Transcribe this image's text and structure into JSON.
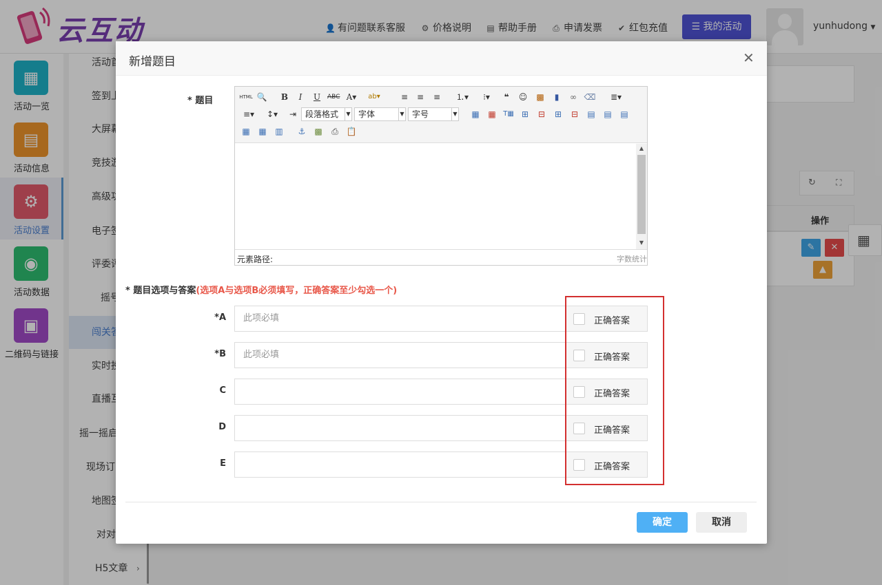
{
  "app": {
    "brand": "云互动"
  },
  "header": {
    "links": [
      {
        "label": "有问题联系客服",
        "icon": "user-plus-icon"
      },
      {
        "label": "价格说明",
        "icon": "gear-icon"
      },
      {
        "label": "帮助手册",
        "icon": "book-icon"
      },
      {
        "label": "申请发票",
        "icon": "printer-icon"
      },
      {
        "label": "红包充值",
        "icon": "shield-check-icon"
      }
    ],
    "my_activity": "我的活动",
    "username": "yunhudong"
  },
  "leftnav": {
    "items": [
      {
        "label": "活动一览",
        "icon": "grid-icon",
        "color": "#1fb3c9"
      },
      {
        "label": "活动信息",
        "icon": "document-icon",
        "color": "#f0962b"
      },
      {
        "label": "活动设置",
        "icon": "gear-icon",
        "color": "#e25b6c"
      },
      {
        "label": "活动数据",
        "icon": "database-icon",
        "color": "#2fbf71"
      },
      {
        "label": "二维码与链接",
        "icon": "qrcode-icon",
        "color": "#a24bc9"
      }
    ]
  },
  "subnav": {
    "items": [
      "活动首",
      "签到上",
      "大屏幕",
      "竞技游",
      "高级功",
      "电子签",
      "评委评",
      "摇号",
      "闯关答",
      "实时投",
      "直播互",
      "摇一摇启",
      "现场订",
      "地图签",
      "对对",
      "H5文章"
    ]
  },
  "content": {
    "action_header": "操作"
  },
  "modal": {
    "title": "新增题目",
    "question_label": "* 题目",
    "editor": {
      "para_format": "段落格式",
      "font": "字体",
      "font_size": "字号",
      "element_path": "元素路径:",
      "word_count": "字数统计"
    },
    "options_title": "* 题目选项与答案",
    "options_hint": "(选项A与选项B必须填写，正确答案至少勾选一个)",
    "options": [
      {
        "label": "*A",
        "placeholder": "此项必填",
        "answer_label": "正确答案"
      },
      {
        "label": "*B",
        "placeholder": "此项必填",
        "answer_label": "正确答案"
      },
      {
        "label": "C",
        "placeholder": "",
        "answer_label": "正确答案"
      },
      {
        "label": "D",
        "placeholder": "",
        "answer_label": "正确答案"
      },
      {
        "label": "E",
        "placeholder": "",
        "answer_label": "正确答案"
      }
    ],
    "ok": "确定",
    "cancel": "取消"
  }
}
